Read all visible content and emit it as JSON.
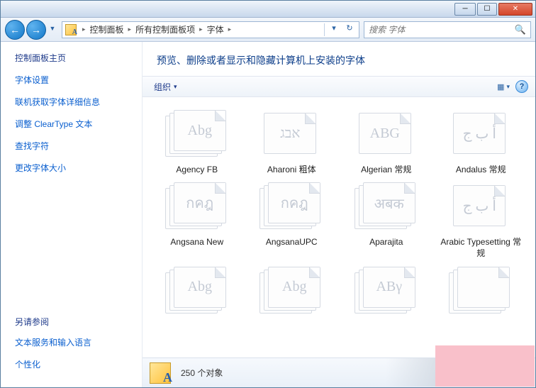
{
  "window": {
    "minimize_glyph": "─",
    "maximize_glyph": "☐",
    "close_glyph": "✕"
  },
  "nav": {
    "back_glyph": "←",
    "forward_glyph": "→",
    "history_glyph": "▼",
    "dropdown_glyph": "▾",
    "refresh_glyph": "↻"
  },
  "breadcrumbs": {
    "sep": "▸",
    "items": [
      "控制面板",
      "所有控制面板项",
      "字体"
    ]
  },
  "search": {
    "placeholder": "搜索 字体",
    "icon_glyph": "🔍"
  },
  "sidebar": {
    "heading": "控制面板主页",
    "links": [
      "字体设置",
      "联机获取字体详细信息",
      "调整 ClearType 文本",
      "查找字符",
      "更改字体大小"
    ],
    "also_heading": "另请参阅",
    "also_links": [
      "文本服务和输入语言",
      "个性化"
    ]
  },
  "content": {
    "title": "预览、删除或者显示和隐藏计算机上安装的字体",
    "organize_label": "组织",
    "view_glyph": "▦",
    "help_glyph": "?"
  },
  "fonts": {
    "row1": [
      {
        "name": "Agency FB",
        "sample": "Abg",
        "multi": true
      },
      {
        "name": "Aharoni 粗体",
        "sample": "אבג",
        "multi": false
      },
      {
        "name": "Algerian 常规",
        "sample": "ABG",
        "multi": false
      },
      {
        "name": "Andalus 常规",
        "sample": "أ ب ج",
        "multi": false
      }
    ],
    "row2": [
      {
        "name": "Angsana New",
        "sample": "กคฎ",
        "multi": true
      },
      {
        "name": "AngsanaUPC",
        "sample": "กคฎ",
        "multi": true
      },
      {
        "name": "Aparajita",
        "sample": "अबक",
        "multi": true
      },
      {
        "name": "Arabic Typesetting 常规",
        "sample": "أ ب ج",
        "multi": false
      }
    ],
    "row3": [
      {
        "name": "",
        "sample": "Abg",
        "multi": true
      },
      {
        "name": "",
        "sample": "Abg",
        "multi": true
      },
      {
        "name": "",
        "sample": "ΑΒγ",
        "multi": true
      },
      {
        "name": "",
        "sample": "",
        "multi": true
      }
    ]
  },
  "status": {
    "count_text": "250 个对象"
  }
}
